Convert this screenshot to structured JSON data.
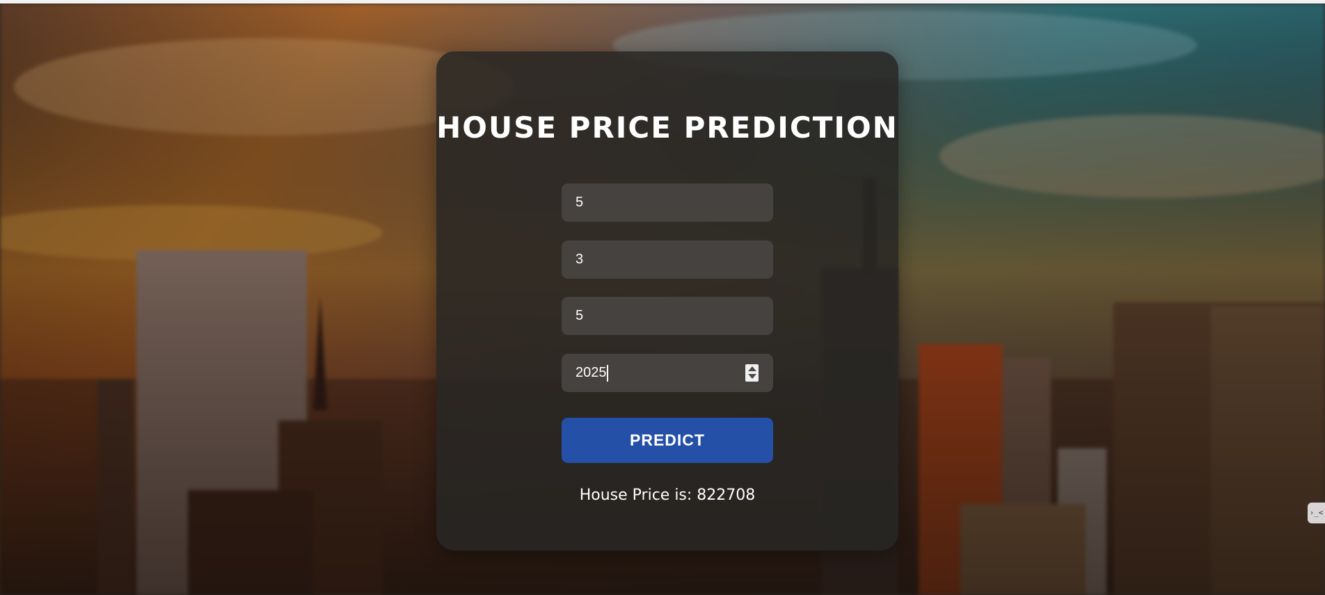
{
  "app": {
    "title": "HOUSE PRICE PREDICTION"
  },
  "form": {
    "fields": [
      {
        "value": "5"
      },
      {
        "value": "3"
      },
      {
        "value": "5"
      },
      {
        "value": "2025",
        "type": "number"
      }
    ],
    "predict_label": "PREDICT",
    "result_text": "House Price is: 822708"
  },
  "colors": {
    "card_bg": "#282624",
    "field_bg": "#46423f",
    "button_bg": "#2450a8",
    "text": "#ffffff"
  },
  "side_widget": {
    "label": "›_<",
    "icon": "terminal-icon"
  }
}
